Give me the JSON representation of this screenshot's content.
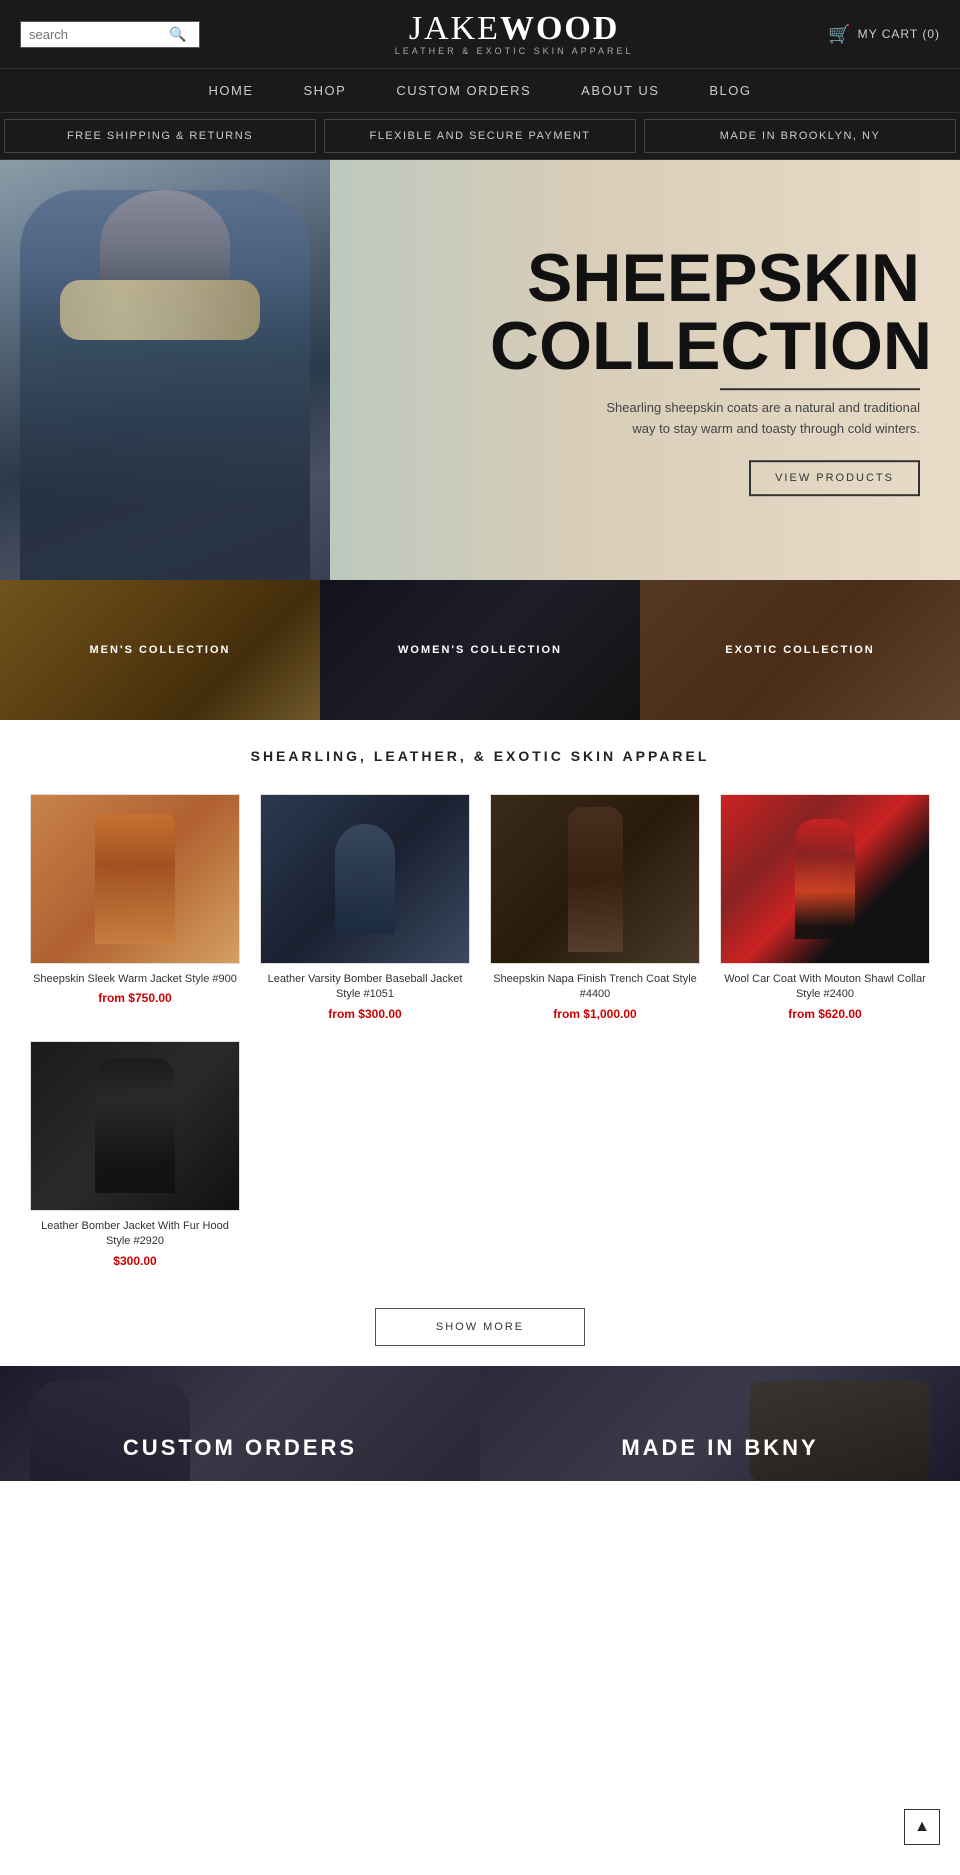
{
  "header": {
    "search_placeholder": "search",
    "logo_line1": "JAKE",
    "logo_line2": "WOOD",
    "logo_sub": "LEATHER & EXOTIC SKIN APPAREL",
    "cart_label": "MY CART (0)"
  },
  "nav": {
    "items": [
      {
        "label": "HOME",
        "id": "home"
      },
      {
        "label": "SHOP",
        "id": "shop"
      },
      {
        "label": "CUSTOM ORDERS",
        "id": "custom-orders"
      },
      {
        "label": "ABOUT US",
        "id": "about-us"
      },
      {
        "label": "BLOG",
        "id": "blog"
      }
    ]
  },
  "promo_bar": {
    "items": [
      {
        "label": "FREE SHIPPING & RETURNS"
      },
      {
        "label": "FLEXIBLE AND SECURE PAYMENT"
      },
      {
        "label": "MADE IN BROOKLYN, NY"
      }
    ]
  },
  "hero": {
    "title_line1": "SHEEPSKIN",
    "title_line2": "COLLECTION",
    "description": "Shearling sheepskin coats are a natural and traditional way to stay warm and toasty through cold winters.",
    "cta_label": "VIEW PRODUCTS"
  },
  "collections": [
    {
      "label": "MEN'S COLLECTION",
      "id": "mens"
    },
    {
      "label": "WOMEN'S COLLECTION",
      "id": "womens"
    },
    {
      "label": "EXOTIC COLLECTION",
      "id": "exotic"
    }
  ],
  "products_section": {
    "title": "SHEARLING, LEATHER, & EXOTIC SKIN APPAREL",
    "products": [
      {
        "name": "Sheepskin Sleek Warm Jacket Style #900",
        "price": "from $750.00",
        "img_class": "prod-img-1"
      },
      {
        "name": "Leather Varsity Bomber Baseball Jacket Style #1051",
        "price": "from $300.00",
        "img_class": "prod-img-2"
      },
      {
        "name": "Sheepskin Napa Finish Trench Coat Style #4400",
        "price": "from $1,000.00",
        "img_class": "prod-img-3"
      },
      {
        "name": "Wool Car Coat With Mouton Shawl Collar Style #2400",
        "price": "from $620.00",
        "img_class": "prod-img-4"
      },
      {
        "name": "Leather Bomber Jacket With Fur Hood Style #2920",
        "price": "$300.00",
        "img_class": "prod-img-5"
      }
    ]
  },
  "show_more": {
    "label": "SHOW MORE"
  },
  "bottom_banners": [
    {
      "label": "CUSTOM ORDERS",
      "id": "custom"
    },
    {
      "label": "MADE IN BKNY",
      "id": "bkny"
    }
  ],
  "scroll_top_label": "▲"
}
